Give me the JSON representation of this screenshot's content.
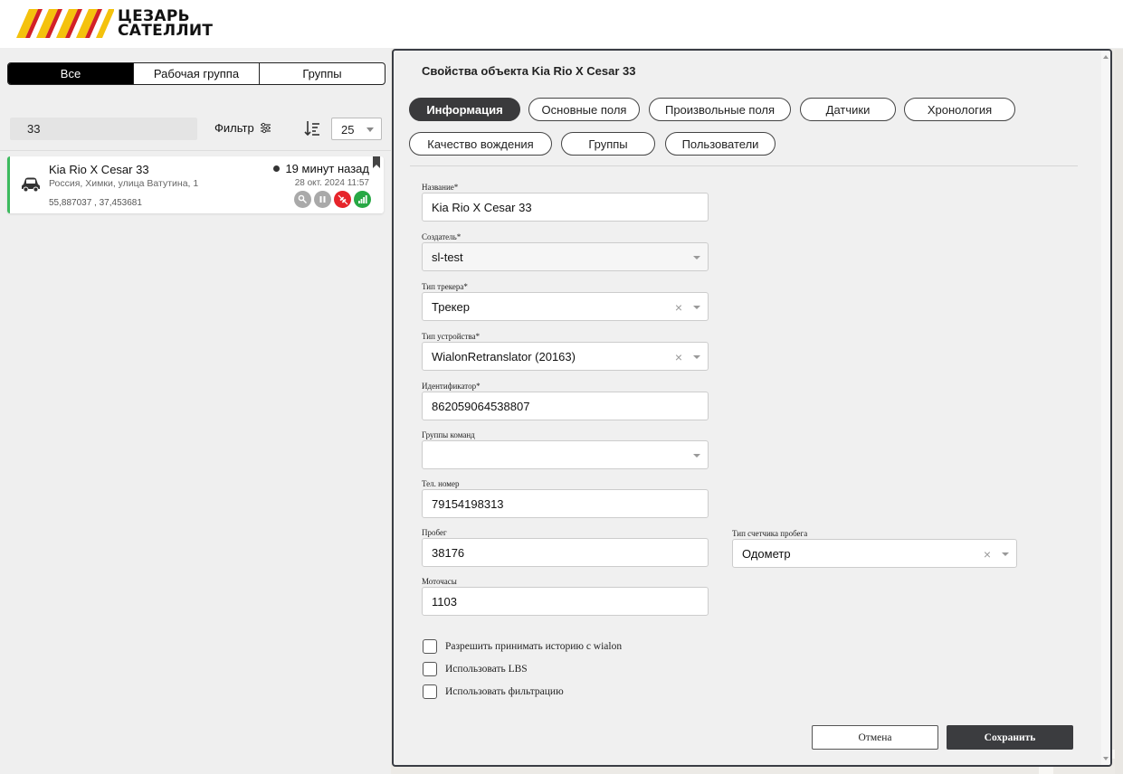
{
  "header": {
    "logo_line1": "ЦЕЗАРЬ",
    "logo_line2": "САТЕЛЛИТ",
    "colors": {
      "stripe_red": "#d32027",
      "stripe_yellow": "#f4c20d"
    }
  },
  "left_panel": {
    "segments": [
      "Все",
      "Рабочая группа",
      "Группы"
    ],
    "search_value": "33",
    "filter_label": "Фильтр",
    "per_page": "25",
    "object": {
      "name": "Kia Rio X Cesar 33",
      "address": "Россия, Химки, улица Ватутина, 1",
      "coords": "55,887037 , 37,453681",
      "ago": "19 минут назад",
      "date": "28 окт. 2024 11:57",
      "status_icons": [
        "key-icon",
        "pause-icon",
        "satellite-off-icon",
        "signal-icon"
      ]
    }
  },
  "modal": {
    "title": "Свойства объекта Kia Rio X Cesar 33",
    "tabs": [
      "Информация",
      "Основные поля",
      "Произвольные поля",
      "Датчики",
      "Хронология",
      "Качество вождения",
      "Группы",
      "Пользователи"
    ],
    "fields": {
      "name": {
        "label": "Название*",
        "value": "Kia Rio X Cesar 33"
      },
      "creator": {
        "label": "Создатель*",
        "value": "sl-test"
      },
      "tracker_type": {
        "label": "Тип трекера*",
        "value": "Трекер"
      },
      "device_type": {
        "label": "Тип устройства*",
        "value": "WialonRetranslator (20163)"
      },
      "identifier": {
        "label": "Идентификатор*",
        "value": "862059064538807"
      },
      "command_groups": {
        "label": "Группы команд",
        "value": ""
      },
      "phone": {
        "label": "Тел. номер",
        "value": "79154198313"
      },
      "mileage": {
        "label": "Пробег",
        "value": "38176"
      },
      "mileage_counter": {
        "label": "Тип счетчика пробега",
        "value": "Одометр"
      },
      "engine_hours": {
        "label": "Моточасы",
        "value": "1103"
      }
    },
    "checkboxes": [
      "Разрешить принимать историю с wialon",
      "Использовать LBS",
      "Использовать фильтрацию"
    ],
    "cancel_label": "Отмена",
    "save_label": "Сохранить"
  }
}
